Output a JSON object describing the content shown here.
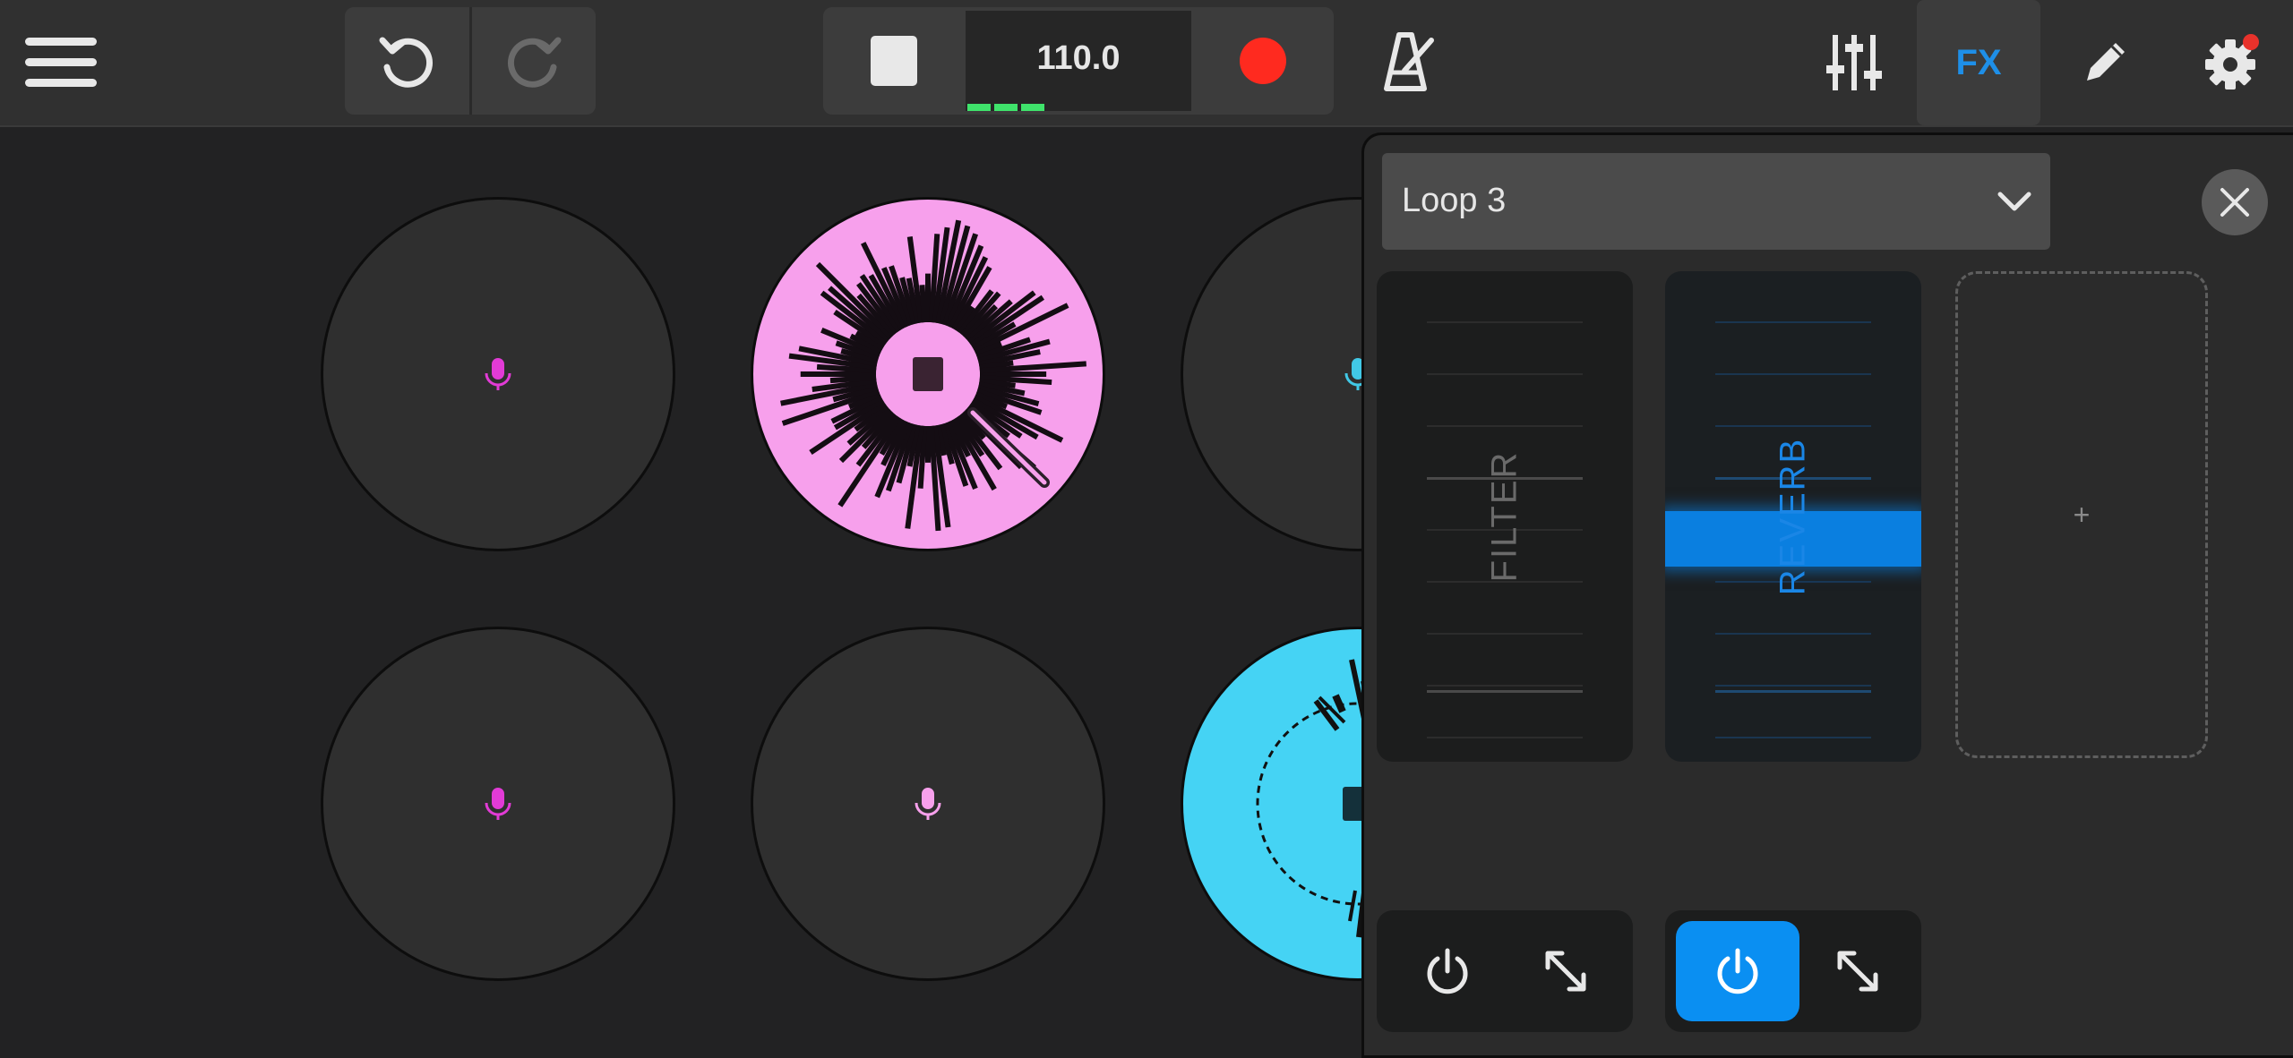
{
  "toolbar": {
    "bpm": "110.0",
    "fx_label": "FX",
    "icons": [
      "menu-icon",
      "undo-icon",
      "redo-icon",
      "stop-icon",
      "record-icon",
      "metronome-icon",
      "mixer-icon",
      "pencil-icon",
      "gear-icon"
    ],
    "colors": {
      "record": "#ff2a1f",
      "fx_active": "#1e8fe8",
      "level": "#3fe36b",
      "notification": "#e8322b"
    }
  },
  "pads": [
    {
      "name": "pad-1",
      "state": "empty",
      "icon": "microphone-icon",
      "color": "#e23bd6"
    },
    {
      "name": "pad-2",
      "state": "playing",
      "color": "#f7a0ec"
    },
    {
      "name": "pad-3",
      "state": "empty",
      "icon": "microphone-icon",
      "color": "#41c8e6"
    },
    {
      "name": "pad-4",
      "state": "empty",
      "icon": "microphone-icon",
      "color": "#e23bd6"
    },
    {
      "name": "pad-5",
      "state": "empty",
      "icon": "microphone-icon",
      "color": "#f7a0ec"
    },
    {
      "name": "pad-6",
      "state": "playing",
      "color": "#45d3f4"
    }
  ],
  "fx_panel": {
    "selected_loop": "Loop 3",
    "effects": [
      {
        "label": "FILTER",
        "enabled": false
      },
      {
        "label": "REVERB",
        "enabled": true,
        "color": "#0a7fe0"
      }
    ],
    "add_slot_label": "+"
  }
}
